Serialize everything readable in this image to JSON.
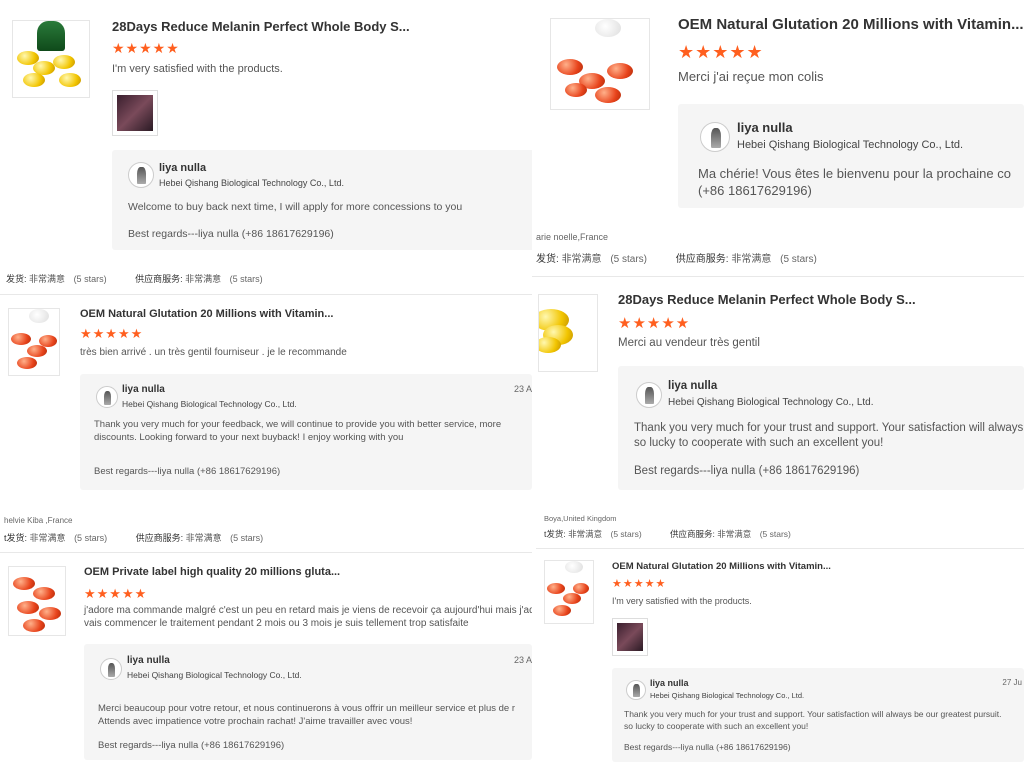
{
  "reviews": [
    {
      "product": "28Days Reduce Melanin Perfect Whole Body S...",
      "stars": "★★★★★",
      "comment": "I'm very satisfied with the products.",
      "replier": "liya nulla",
      "company": "Hebei Qishang Biological Technology Co., Ltd.",
      "reply_lines": [
        "Welcome to buy back next time, I will apply for more concessions to you"
      ],
      "signoff": "Best regards---liya nulla (+86 18617629196)"
    },
    {
      "product": "OEM Natural Glutation 20 Millions with Vitamin...",
      "stars": "★★★★★",
      "comment": "Merci j'ai reçue mon colis",
      "replier": "liya nulla",
      "company": "Hebei Qishang Biological Technology Co., Ltd.",
      "reply_lines": [
        "Ma chérie! Vous êtes le bienvenu pour la prochaine co",
        "(+86 18617629196)"
      ]
    },
    {
      "product": "OEM Natural Glutation 20 Millions with Vitamin...",
      "stars": "★★★★★",
      "comment": "très bien arrivé . un très  gentil fourniseur  . je le recommande",
      "replier": "liya nulla",
      "company": "Hebei Qishang Biological Technology Co., Ltd.",
      "date": "23 A",
      "reply_lines": [
        "Thank you very much for your feedback, we will continue to provide you with better service, more",
        "discounts. Looking forward to your next buyback! I enjoy working with you"
      ],
      "signoff": "Best regards---liya nulla (+86 18617629196)"
    },
    {
      "product": "28Days Reduce Melanin Perfect Whole Body S...",
      "stars": "★★★★★",
      "comment": "Merci au vendeur très gentil",
      "replier": "liya nulla",
      "company": "Hebei Qishang Biological Technology Co., Ltd.",
      "reply_lines": [
        "Thank you very much for your trust and support. Your satisfaction will always",
        "so lucky to cooperate with such an excellent you!"
      ],
      "signoff": "Best regards---liya nulla (+86 18617629196)"
    },
    {
      "product": "OEM Private label high quality 20 millions gluta...",
      "stars": "★★★★★",
      "comment_lines": [
        "j'adore ma commande malgré c'est un peu en retard mais je viens de recevoir ça aujourd'hui mais j'ado",
        "vais commencer le traitement pendant 2 mois ou 3 mois je suis tellement trop satisfaite"
      ],
      "replier": "liya nulla",
      "company": "Hebei Qishang Biological Technology Co., Ltd.",
      "date": "23 A",
      "reply_lines": [
        "Merci beaucoup pour votre retour, et nous continuerons à vous offrir un meilleur service et plus de r",
        "Attends avec impatience votre prochain rachat! J'aime travailler avec vous!"
      ],
      "signoff": "Best regards---liya nulla (+86 18617629196)"
    },
    {
      "product": "OEM Natural Glutation 20 Millions with Vitamin...",
      "stars": "★★★★★",
      "comment": "I'm very satisfied with the products.",
      "replier": "liya nulla",
      "company": "Hebei Qishang Biological Technology Co., Ltd.",
      "date": "27 Ju",
      "reply_lines": [
        "Thank you very much for your trust and support. Your satisfaction will always be our greatest pursuit.",
        "so lucky to cooperate with such an excellent you!"
      ],
      "signoff": "Best regards---liya nulla (+86 18617629196)"
    }
  ],
  "meta_rows": [
    {
      "shipping_key": "发货:",
      "shipping_val": "非常满意",
      "shipping_stars": "(5 stars)",
      "service_key": "供应商服务:",
      "service_val": "非常满意",
      "service_stars": "(5 stars)"
    },
    {
      "reviewer": "arie noelle,France",
      "shipping_key": "发货:",
      "shipping_val": "非常满意",
      "shipping_stars": "(5 stars)",
      "service_key": "供应商服务:",
      "service_val": "非常满意",
      "service_stars": "(5 stars)"
    },
    {
      "reviewer": "helvie Kiba ,France",
      "shipping_key": "t发货:",
      "shipping_val": "非常满意",
      "shipping_stars": "(5 stars)",
      "service_key": "供应商服务:",
      "service_val": "非常满意",
      "service_stars": "(5 stars)"
    },
    {
      "reviewer": "Boya,United Kingdom",
      "shipping_key": "t发货:",
      "shipping_val": "非常满意",
      "shipping_stars": "(5 stars)",
      "service_key": "供应商服务:",
      "service_val": "非常满意",
      "service_stars": "(5 stars)"
    }
  ],
  "colors": {
    "star": "#ff5f1f",
    "reply_bg": "#f5f5f5",
    "border": "#e8e8e8"
  },
  "icons": [
    "avatar-icon",
    "product-thumbnail",
    "attachment-thumbnail"
  ]
}
